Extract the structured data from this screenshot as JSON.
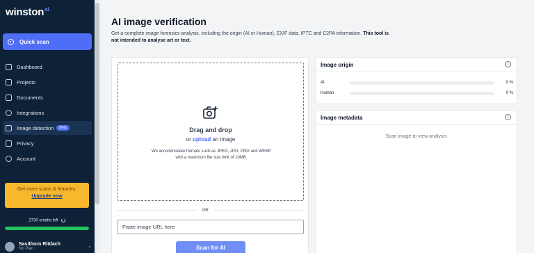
{
  "sidebar": {
    "logo": "winston",
    "logo_badge": "ai",
    "quick_scan": "Quick scan",
    "items": [
      {
        "label": "Dashboard",
        "icon": "rocket-icon"
      },
      {
        "label": "Projects",
        "icon": "folder-icon"
      },
      {
        "label": "Documents",
        "icon": "document-icon"
      },
      {
        "label": "Integrations",
        "icon": "integrations-icon"
      },
      {
        "label": "Image detection",
        "icon": "image-icon",
        "badge": "Beta",
        "active": true
      },
      {
        "label": "Privacy",
        "icon": "shield-icon"
      },
      {
        "label": "Account",
        "icon": "user-icon"
      }
    ],
    "promo": {
      "text": "Get more scans & features.",
      "link": "Upgrade now"
    },
    "credits": {
      "text": "2730 credits left",
      "fill_fraction": 1.0
    },
    "user": {
      "name": "Sasithorn Ritdach",
      "plan": "No Plan"
    }
  },
  "main": {
    "title": "AI image verification",
    "description": "Get a complete image forensics analysis, including the origin (AI or Human), EXIF data, IPTC and C2PA information.",
    "description_bold": "This tool is not intended to analyse art or text.",
    "dropzone": {
      "title": "Drag and drop",
      "sub_prefix": "or",
      "sub_link": "upload",
      "sub_suffix": "an image",
      "formats": "We accommodate formats such as JPEG, JPG, PNG and WEBP with a maximum file size limit of 10MB."
    },
    "or_label": "OR",
    "url_placeholder": "Paste image URL here",
    "scan_button": "Scan for AI"
  },
  "origin": {
    "title": "Image origin",
    "rows": [
      {
        "label": "AI",
        "value": "0 %",
        "fraction": 0
      },
      {
        "label": "Human",
        "value": "0 %",
        "fraction": 0
      }
    ]
  },
  "metadata": {
    "title": "Image metadata",
    "empty_text": "Scan image to view analysis"
  },
  "colors": {
    "sidebar_bg": "#0d2137",
    "accent": "#4f6ef7",
    "promo": "#f8b82e",
    "credits_bar": "#22c55e"
  }
}
